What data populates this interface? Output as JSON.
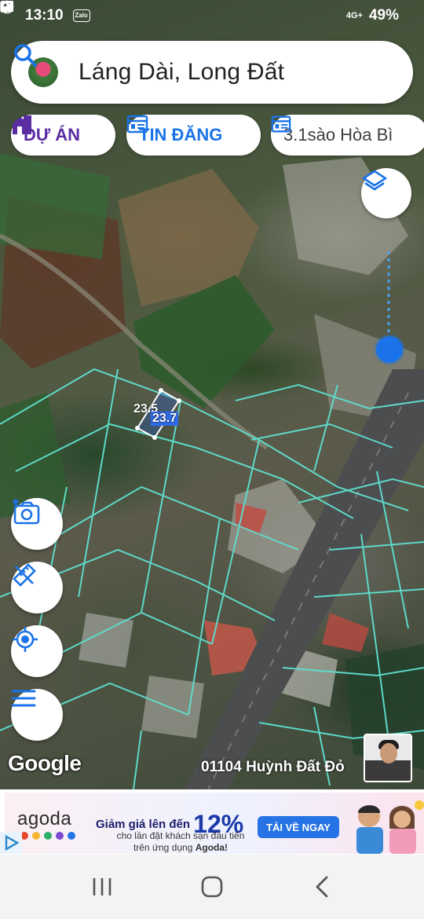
{
  "status_bar": {
    "time": "13:10",
    "left_icons": [
      "gallery-icon",
      "zalo-icon",
      "chrome-icon"
    ],
    "zalo_label": "Zalo",
    "network": "4G+",
    "battery": "49%"
  },
  "search": {
    "query": "Láng Dài, Long Đất"
  },
  "chips": [
    {
      "label": "DỰ ÁN",
      "icon": "building-icon",
      "color": "#5a2da3"
    },
    {
      "label": "TIN ĐĂNG",
      "icon": "list-card-icon",
      "color": "#1a73e8"
    },
    {
      "label": "3.1sào Hòa Bì",
      "icon": "list-card-icon",
      "color": "#3c4043"
    }
  ],
  "map": {
    "plot_labels": [
      "23.5",
      "23.7"
    ],
    "attribution": "Google",
    "caption": "01104 Huỳnh Đất Đỏ",
    "parcel_line_color": "#5fe0d0",
    "location_dot_color": "#1a73e8"
  },
  "controls": [
    "layers-icon",
    "add-photo-icon",
    "measure-icon",
    "my-location-icon",
    "menu-icon"
  ],
  "ad": {
    "brand": "agoda",
    "headline_prefix": "Giảm giá lên đến",
    "headline_value": "12%",
    "sub_line1": "cho lần đặt khách sạn đầu tiên",
    "sub_line2_prefix": "trên ứng dụng",
    "sub_line2_brand": "Agoda!",
    "cta": "TẢI VỀ NGAY",
    "dot_colors": [
      "#e8462c",
      "#f7b733",
      "#2bae66",
      "#7b4bd0",
      "#2673e6"
    ]
  }
}
